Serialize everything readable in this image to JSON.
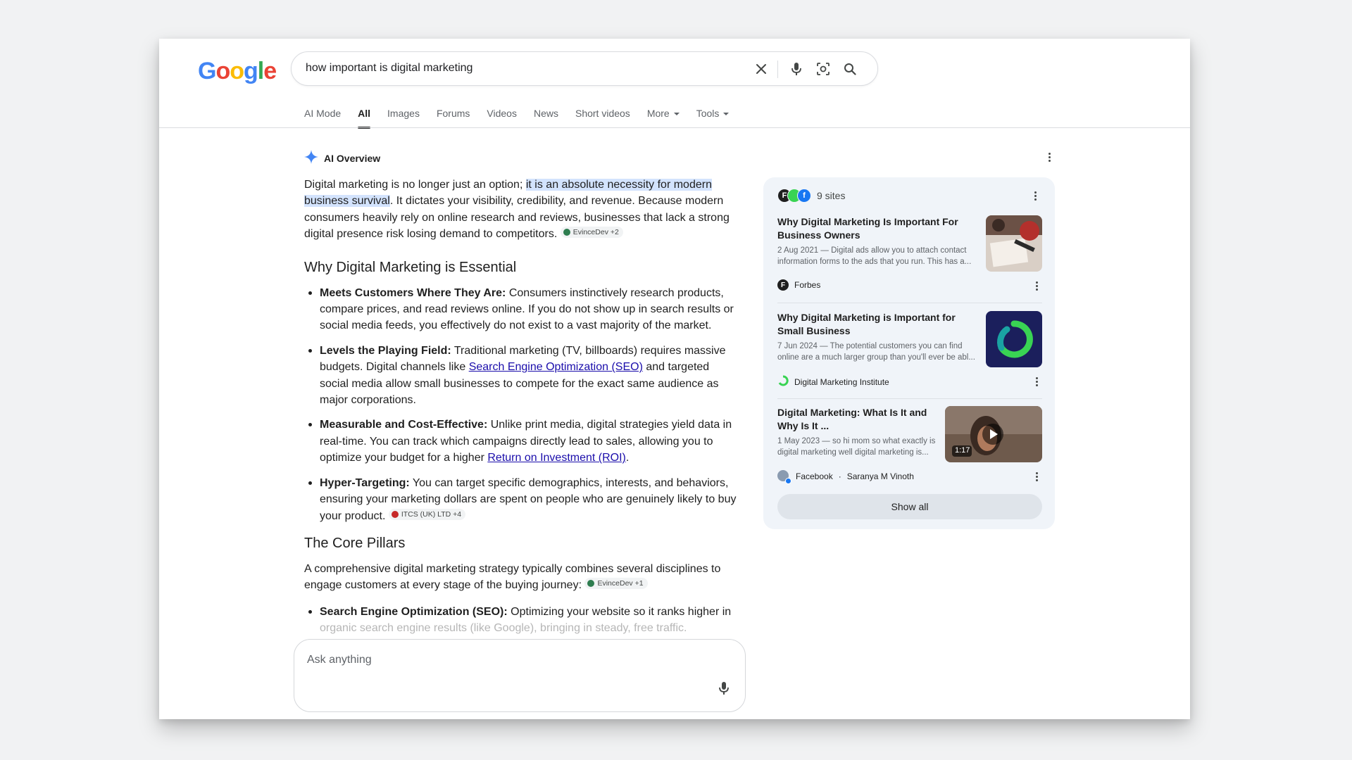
{
  "header": {
    "logo": "Google",
    "search_query": "how important is digital marketing"
  },
  "tabs": [
    {
      "label": "AI Mode"
    },
    {
      "label": "All",
      "active": true
    },
    {
      "label": "Images"
    },
    {
      "label": "Forums"
    },
    {
      "label": "Videos"
    },
    {
      "label": "News"
    },
    {
      "label": "Short videos"
    },
    {
      "label": "More"
    },
    {
      "label": "Tools"
    }
  ],
  "ai_overview": {
    "heading": "AI Overview",
    "intro_before": "Digital marketing is no longer just an option; ",
    "intro_highlight": "it is an absolute necessity for modern business survival",
    "intro_after": ". It dictates your visibility, credibility, and revenue. Because modern consumers heavily rely on online research and reviews, businesses that lack a strong digital presence risk losing demand to competitors.",
    "intro_chip": "EvinceDev +2",
    "section1_title": "Why Digital Marketing is Essential",
    "bullets": [
      {
        "bold": "Meets Customers Where They Are:",
        "text": " Consumers instinctively research products, compare prices, and read reviews online. If you do not show up in search results or social media feeds, you effectively do not exist to a vast majority of the market."
      },
      {
        "bold": "Levels the Playing Field:",
        "text_before": " Traditional marketing (TV, billboards) requires massive budgets. Digital channels like ",
        "link": "Search Engine Optimization (SEO)",
        "text_after": " and targeted social media allow small businesses to compete for the exact same audience as major corporations."
      },
      {
        "bold": "Measurable and Cost-Effective:",
        "text_before": " Unlike print media, digital strategies yield data in real-time. You can track which campaigns directly lead to sales, allowing you to optimize your budget for a higher ",
        "link": "Return on Investment (ROI)",
        "text_after": "."
      },
      {
        "bold": "Hyper-Targeting:",
        "text": " You can target specific demographics, interests, and behaviors, ensuring your marketing dollars are spent on people who are genuinely likely to buy your product.",
        "chip": "ITCS (UK) LTD +4"
      }
    ],
    "section2_title": "The Core Pillars",
    "section2_text": "A comprehensive digital marketing strategy typically combines several disciplines to engage customers at every stage of the buying journey:",
    "section2_chip": "EvinceDev +1",
    "pillar_bold": "Search Engine Optimization (SEO):",
    "pillar_text": " Optimizing your website so it ranks higher in",
    "pillar_fade": "organic search engine results (like Google), bringing in steady, free traffic."
  },
  "ask": {
    "placeholder": "Ask anything"
  },
  "sources_panel": {
    "count_label": "9 sites",
    "cards": [
      {
        "title": "Why Digital Marketing Is Important For Business Owners",
        "snippet": "2 Aug 2021 — Digital ads allow you to attach contact information forms to the ads that you run. This has a...",
        "source": "Forbes"
      },
      {
        "title": "Why Digital Marketing is Important for Small Business",
        "snippet": "7 Jun 2024 — The potential customers you can find online are a much larger group than you'll ever be abl...",
        "source": "Digital Marketing Institute"
      },
      {
        "title": "Digital Marketing: What Is It and Why Is It ...",
        "snippet": "1 May 2023 — so hi mom so what exactly is digital marketing well digital marketing is...",
        "source": "Facebook",
        "source_sep": "·",
        "source_author": "Saranya M Vinoth",
        "duration": "1:17"
      }
    ],
    "show_all": "Show all"
  },
  "colors": {
    "link": "#1a0dab",
    "highlight": "#d3e3fd",
    "panel_bg": "#f0f4f9",
    "dmi_green": "#39d353"
  }
}
